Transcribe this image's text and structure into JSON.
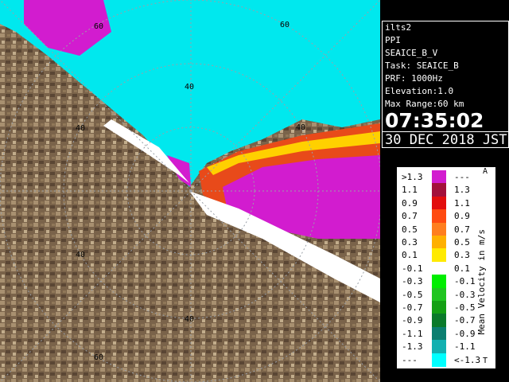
{
  "info": {
    "site": "ilts2",
    "mode": "PPI",
    "product": "SEAICE_B_V",
    "task": "Task: SEAICE_B",
    "prf": "PRF: 1000Hz",
    "elevation": "Elevation:1.0",
    "max_range": "Max Range:60 km",
    "time": "07:35:02",
    "date": "30 DEC 2018 JST"
  },
  "range_labels": [
    "60",
    "40",
    "40",
    "40",
    "40",
    "40",
    "60",
    "60"
  ],
  "legend": {
    "caption": "Mean Velocity in m/s",
    "top_mark": "A",
    "bottom_mark": "T",
    "rows": [
      {
        "lo": ">1.3",
        "hi": "---",
        "color": "#d21ccf"
      },
      {
        "lo": "1.1",
        "hi": "1.3",
        "color": "#a3103b"
      },
      {
        "lo": "0.9",
        "hi": "1.1",
        "color": "#e20d0d"
      },
      {
        "lo": "0.7",
        "hi": "0.9",
        "color": "#ff4a10"
      },
      {
        "lo": "0.5",
        "hi": "0.7",
        "color": "#ff7e1e"
      },
      {
        "lo": "0.3",
        "hi": "0.5",
        "color": "#ffb000"
      },
      {
        "lo": "0.1",
        "hi": "0.3",
        "color": "#ffea00"
      },
      {
        "lo": "-0.1",
        "hi": "0.1",
        "color": "#ffffff"
      },
      {
        "lo": "-0.3",
        "hi": "-0.1",
        "color": "#00ee00"
      },
      {
        "lo": "-0.5",
        "hi": "-0.3",
        "color": "#20c520"
      },
      {
        "lo": "-0.7",
        "hi": "-0.5",
        "color": "#14a014"
      },
      {
        "lo": "-0.9",
        "hi": "-0.7",
        "color": "#0a7a2a"
      },
      {
        "lo": "-1.1",
        "hi": "-0.9",
        "color": "#0b7f70"
      },
      {
        "lo": "-1.3",
        "hi": "-1.1",
        "color": "#12b0b0"
      },
      {
        "lo": "---",
        "hi": "<-1.3",
        "color": "#00ffff"
      }
    ]
  },
  "colors": {
    "sea": "#00e8ee",
    "land": "#7a634a",
    "land_light": "#b09a7a",
    "approach": "#d21ccf"
  }
}
